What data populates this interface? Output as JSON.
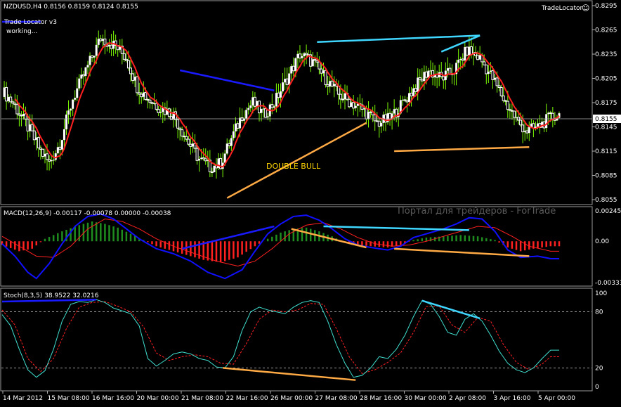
{
  "colors": {
    "background": "#000000",
    "bull_candle": "#ffffff",
    "bear_candle": "#ffffff",
    "wick": "#7cfc00",
    "ma_line": "#ff2020",
    "macd_positive": "#1f8c1f",
    "macd_negative": "#ff2020",
    "macd_line": "#1010ff",
    "signal_line": "#ff2020",
    "stoch_main": "#40e0d0",
    "stoch_signal": "#ff2020",
    "trend_blue": "#1a1aff",
    "trend_cyan": "#3fd6ff",
    "trend_orange": "#ffaa44",
    "annotation_text": "#ffd700",
    "grid_border": "#b0b0b0"
  },
  "header": {
    "symbol_line": "NZDUSD,H4  0.8156 0.8159 0.8124 0.8155",
    "indicator_name": "Trade Locator v3",
    "indicator_status": "working...",
    "corner_label": "TradeLocator",
    "smiley_icon": "☺"
  },
  "watermark": "Портал для трейдеров - ForTrade",
  "annotation": "DOUBLE BULL",
  "price_labels": [
    "0.8295",
    "0.8265",
    "0.8235",
    "0.8205",
    "0.8175",
    "0.8145",
    "0.8115",
    "0.8085",
    "0.8055"
  ],
  "current_price": "0.8155",
  "macd_title": "MACD(12,26,9) -0.00117 -0.00078 0.00000 -0.00038",
  "macd_labels": [
    "0.00245",
    "0.00",
    "-0.00333"
  ],
  "stoch_title": "Stoch(8,3,5) 38.9522 32.0216",
  "stoch_labels": [
    "100",
    "80",
    "20",
    "0"
  ],
  "time_labels": [
    "14 Mar 2012",
    "15 Mar 08:00",
    "16 Mar 16:00",
    "20 Mar 00:00",
    "21 Mar 08:00",
    "22 Mar 16:00",
    "26 Mar 00:00",
    "27 Mar 08:00",
    "28 Mar 16:00",
    "30 Mar 00:00",
    "2 Apr 08:00",
    "3 Apr 16:00",
    "5 Apr 00:00"
  ],
  "chart_data": {
    "type": "candlestick",
    "symbol": "NZDUSD",
    "timeframe": "H4",
    "last_ohlc": {
      "open": 0.8156,
      "high": 0.8159,
      "low": 0.8124,
      "close": 0.8155
    },
    "price_axis": [
      0.8055,
      0.8295
    ],
    "price_path": [
      [
        0,
        0.819
      ],
      [
        5,
        0.8175
      ],
      [
        12,
        0.8145
      ],
      [
        18,
        0.8115
      ],
      [
        22,
        0.81
      ],
      [
        27,
        0.8125
      ],
      [
        33,
        0.818
      ],
      [
        40,
        0.822
      ],
      [
        46,
        0.8255
      ],
      [
        53,
        0.8245
      ],
      [
        58,
        0.823
      ],
      [
        63,
        0.8195
      ],
      [
        68,
        0.818
      ],
      [
        73,
        0.817
      ],
      [
        80,
        0.816
      ],
      [
        86,
        0.813
      ],
      [
        92,
        0.8105
      ],
      [
        97,
        0.8095
      ],
      [
        102,
        0.81
      ],
      [
        107,
        0.813
      ],
      [
        112,
        0.816
      ],
      [
        117,
        0.8175
      ],
      [
        122,
        0.816
      ],
      [
        127,
        0.8175
      ],
      [
        133,
        0.8205
      ],
      [
        139,
        0.8235
      ],
      [
        145,
        0.8225
      ],
      [
        151,
        0.8205
      ],
      [
        157,
        0.8185
      ],
      [
        163,
        0.8175
      ],
      [
        169,
        0.8165
      ],
      [
        175,
        0.815
      ],
      [
        181,
        0.8155
      ],
      [
        187,
        0.8175
      ],
      [
        193,
        0.8195
      ],
      [
        199,
        0.8215
      ],
      [
        205,
        0.8205
      ],
      [
        211,
        0.8215
      ],
      [
        217,
        0.824
      ],
      [
        223,
        0.823
      ],
      [
        229,
        0.8205
      ],
      [
        235,
        0.8175
      ],
      [
        241,
        0.815
      ],
      [
        245,
        0.814
      ],
      [
        250,
        0.8145
      ],
      [
        255,
        0.8155
      ],
      [
        260,
        0.816
      ]
    ],
    "ma_period_shift": 4,
    "trendlines_price": [
      {
        "name": "top-left-blue",
        "color": "trend_blue",
        "points": [
          [
            0,
            0.8275
          ],
          [
            18,
            0.8275
          ]
        ]
      },
      {
        "name": "blue-resistance",
        "color": "trend_blue",
        "points": [
          [
            83,
            0.8215
          ],
          [
            127,
            0.819
          ]
        ]
      },
      {
        "name": "double-bull-orange",
        "color": "trend_orange",
        "points": [
          [
            105,
            0.8057
          ],
          [
            170,
            0.815
          ]
        ]
      },
      {
        "name": "cyan-top-long",
        "color": "trend_cyan",
        "points": [
          [
            147,
            0.825
          ],
          [
            223,
            0.8258
          ]
        ]
      },
      {
        "name": "cyan-top-short",
        "color": "trend_cyan",
        "points": [
          [
            205,
            0.8238
          ],
          [
            223,
            0.8258
          ]
        ]
      },
      {
        "name": "orange-bottom",
        "color": "trend_orange",
        "points": [
          [
            183,
            0.8115
          ],
          [
            246,
            0.812
          ]
        ]
      }
    ],
    "macd": {
      "axis": [
        -0.00333,
        0.00245
      ],
      "histogram_path": [
        [
          0,
          -0.0003
        ],
        [
          8,
          -0.0008
        ],
        [
          14,
          -0.0006
        ],
        [
          20,
          0.0002
        ],
        [
          28,
          0.0008
        ],
        [
          36,
          0.0013
        ],
        [
          42,
          0.0016
        ],
        [
          48,
          0.0014
        ],
        [
          54,
          0.0011
        ],
        [
          60,
          0.0006
        ],
        [
          66,
          0.0001
        ],
        [
          72,
          -0.0004
        ],
        [
          78,
          -0.0007
        ],
        [
          86,
          -0.0011
        ],
        [
          94,
          -0.0015
        ],
        [
          102,
          -0.0017
        ],
        [
          110,
          -0.0013
        ],
        [
          118,
          -0.0004
        ],
        [
          124,
          0.0002
        ],
        [
          130,
          0.0007
        ],
        [
          136,
          0.001
        ],
        [
          142,
          0.0011
        ],
        [
          148,
          0.0008
        ],
        [
          154,
          0.0004
        ],
        [
          160,
          -0.0001
        ],
        [
          166,
          -0.0003
        ],
        [
          172,
          -0.0004
        ],
        [
          180,
          -0.0005
        ],
        [
          186,
          -0.0003
        ],
        [
          192,
          0.0001
        ],
        [
          198,
          0.0003
        ],
        [
          206,
          0.0004
        ],
        [
          214,
          0.0005
        ],
        [
          222,
          0.0004
        ],
        [
          230,
          0.0001
        ],
        [
          236,
          -0.0005
        ],
        [
          242,
          -0.0008
        ],
        [
          248,
          -0.0006
        ],
        [
          256,
          -0.0004
        ]
      ],
      "macd_path": [
        [
          0,
          -0.0002
        ],
        [
          6,
          -0.0012
        ],
        [
          12,
          -0.0025
        ],
        [
          16,
          -0.003
        ],
        [
          22,
          -0.0018
        ],
        [
          28,
          -0.0002
        ],
        [
          34,
          0.0012
        ],
        [
          40,
          0.002
        ],
        [
          46,
          0.0022
        ],
        [
          52,
          0.0018
        ],
        [
          58,
          0.001
        ],
        [
          64,
          0.0002
        ],
        [
          72,
          -0.0006
        ],
        [
          80,
          -0.001
        ],
        [
          88,
          -0.0016
        ],
        [
          96,
          -0.0025
        ],
        [
          104,
          -0.003
        ],
        [
          112,
          -0.0023
        ],
        [
          118,
          -0.0008
        ],
        [
          124,
          0.0006
        ],
        [
          130,
          0.0014
        ],
        [
          136,
          0.002
        ],
        [
          142,
          0.0021
        ],
        [
          148,
          0.0017
        ],
        [
          154,
          0.001
        ],
        [
          160,
          0.0002
        ],
        [
          166,
          -0.0003
        ],
        [
          172,
          -0.0005
        ],
        [
          180,
          -0.0007
        ],
        [
          186,
          -0.0004
        ],
        [
          192,
          0.0003
        ],
        [
          200,
          0.0007
        ],
        [
          206,
          0.001
        ],
        [
          212,
          0.0014
        ],
        [
          218,
          0.0019
        ],
        [
          224,
          0.0018
        ],
        [
          230,
          0.0008
        ],
        [
          236,
          -0.0007
        ],
        [
          242,
          -0.0013
        ],
        [
          250,
          -0.0012
        ],
        [
          256,
          -0.0014
        ]
      ],
      "signal_path": [
        [
          0,
          0.0004
        ],
        [
          8,
          -0.0004
        ],
        [
          16,
          -0.0012
        ],
        [
          24,
          -0.0013
        ],
        [
          32,
          -0.0004
        ],
        [
          40,
          0.001
        ],
        [
          48,
          0.0018
        ],
        [
          56,
          0.0016
        ],
        [
          64,
          0.001
        ],
        [
          72,
          0.0002
        ],
        [
          80,
          -0.0004
        ],
        [
          90,
          -0.001
        ],
        [
          100,
          -0.0016
        ],
        [
          110,
          -0.002
        ],
        [
          118,
          -0.0016
        ],
        [
          126,
          -0.0006
        ],
        [
          134,
          0.0006
        ],
        [
          142,
          0.0013
        ],
        [
          150,
          0.0015
        ],
        [
          158,
          0.001
        ],
        [
          166,
          0.0003
        ],
        [
          174,
          -0.0002
        ],
        [
          182,
          -0.0004
        ],
        [
          190,
          -0.0003
        ],
        [
          198,
          0.0
        ],
        [
          206,
          0.0004
        ],
        [
          214,
          0.0008
        ],
        [
          222,
          0.0012
        ],
        [
          230,
          0.0011
        ],
        [
          238,
          0.0004
        ],
        [
          246,
          -0.0004
        ],
        [
          256,
          -0.0008
        ]
      ],
      "trendlines": [
        {
          "name": "macd-blue",
          "color": "trend_blue",
          "points": [
            [
              84,
              -0.0006
            ],
            [
              127,
              0.0012
            ]
          ]
        },
        {
          "name": "macd-orange",
          "color": "trend_orange",
          "points": [
            [
              135,
              0.001
            ],
            [
              170,
              -0.0005
            ]
          ]
        },
        {
          "name": "macd-cyan",
          "color": "trend_cyan",
          "points": [
            [
              150,
              0.0012
            ],
            [
              218,
              0.0009
            ]
          ]
        },
        {
          "name": "macd-orange-long",
          "color": "trend_orange",
          "points": [
            [
              183,
              -0.0006
            ],
            [
              246,
              -0.0012
            ]
          ]
        }
      ]
    },
    "stochastic": {
      "axis": [
        0,
        100
      ],
      "levels": [
        80,
        20
      ],
      "main_path": [
        [
          0,
          77
        ],
        [
          4,
          65
        ],
        [
          8,
          40
        ],
        [
          12,
          18
        ],
        [
          16,
          10
        ],
        [
          20,
          17
        ],
        [
          24,
          40
        ],
        [
          28,
          70
        ],
        [
          32,
          88
        ],
        [
          36,
          91
        ],
        [
          40,
          90
        ],
        [
          44,
          93
        ],
        [
          48,
          90
        ],
        [
          52,
          84
        ],
        [
          56,
          81
        ],
        [
          60,
          78
        ],
        [
          64,
          65
        ],
        [
          68,
          30
        ],
        [
          72,
          22
        ],
        [
          76,
          28
        ],
        [
          80,
          35
        ],
        [
          84,
          37
        ],
        [
          88,
          35
        ],
        [
          92,
          30
        ],
        [
          96,
          28
        ],
        [
          100,
          21
        ],
        [
          104,
          20
        ],
        [
          108,
          32
        ],
        [
          112,
          60
        ],
        [
          116,
          80
        ],
        [
          120,
          85
        ],
        [
          124,
          82
        ],
        [
          128,
          80
        ],
        [
          132,
          78
        ],
        [
          136,
          85
        ],
        [
          140,
          90
        ],
        [
          144,
          92
        ],
        [
          148,
          90
        ],
        [
          152,
          70
        ],
        [
          156,
          45
        ],
        [
          160,
          25
        ],
        [
          164,
          10
        ],
        [
          168,
          12
        ],
        [
          172,
          20
        ],
        [
          176,
          32
        ],
        [
          180,
          30
        ],
        [
          184,
          40
        ],
        [
          188,
          55
        ],
        [
          192,
          75
        ],
        [
          196,
          92
        ],
        [
          200,
          88
        ],
        [
          204,
          75
        ],
        [
          208,
          58
        ],
        [
          212,
          55
        ],
        [
          216,
          72
        ],
        [
          220,
          78
        ],
        [
          224,
          70
        ],
        [
          228,
          55
        ],
        [
          232,
          38
        ],
        [
          236,
          25
        ],
        [
          240,
          18
        ],
        [
          244,
          15
        ],
        [
          248,
          20
        ],
        [
          252,
          30
        ],
        [
          256,
          39
        ]
      ],
      "signal_path": [
        [
          0,
          82
        ],
        [
          6,
          66
        ],
        [
          12,
          30
        ],
        [
          18,
          16
        ],
        [
          24,
          30
        ],
        [
          30,
          62
        ],
        [
          36,
          85
        ],
        [
          42,
          90
        ],
        [
          48,
          91
        ],
        [
          54,
          86
        ],
        [
          60,
          80
        ],
        [
          66,
          64
        ],
        [
          72,
          36
        ],
        [
          78,
          28
        ],
        [
          84,
          32
        ],
        [
          90,
          34
        ],
        [
          96,
          32
        ],
        [
          102,
          25
        ],
        [
          108,
          24
        ],
        [
          114,
          46
        ],
        [
          120,
          72
        ],
        [
          126,
          82
        ],
        [
          132,
          80
        ],
        [
          138,
          82
        ],
        [
          144,
          89
        ],
        [
          150,
          88
        ],
        [
          156,
          62
        ],
        [
          162,
          32
        ],
        [
          168,
          14
        ],
        [
          174,
          18
        ],
        [
          180,
          26
        ],
        [
          186,
          36
        ],
        [
          192,
          58
        ],
        [
          198,
          86
        ],
        [
          204,
          86
        ],
        [
          210,
          66
        ],
        [
          216,
          58
        ],
        [
          222,
          74
        ],
        [
          228,
          70
        ],
        [
          234,
          45
        ],
        [
          240,
          26
        ],
        [
          246,
          18
        ],
        [
          252,
          24
        ],
        [
          256,
          32
        ]
      ],
      "trendlines": [
        {
          "name": "stoch-blue",
          "color": "trend_blue",
          "points": [
            [
              0,
              91
            ],
            [
              44,
              93
            ]
          ]
        },
        {
          "name": "stoch-orange",
          "color": "trend_orange",
          "points": [
            [
              103,
              20
            ],
            [
              165,
              7
            ]
          ]
        },
        {
          "name": "stoch-cyan",
          "color": "trend_cyan",
          "points": [
            [
              196,
              92
            ],
            [
              223,
              73
            ]
          ]
        }
      ]
    }
  }
}
